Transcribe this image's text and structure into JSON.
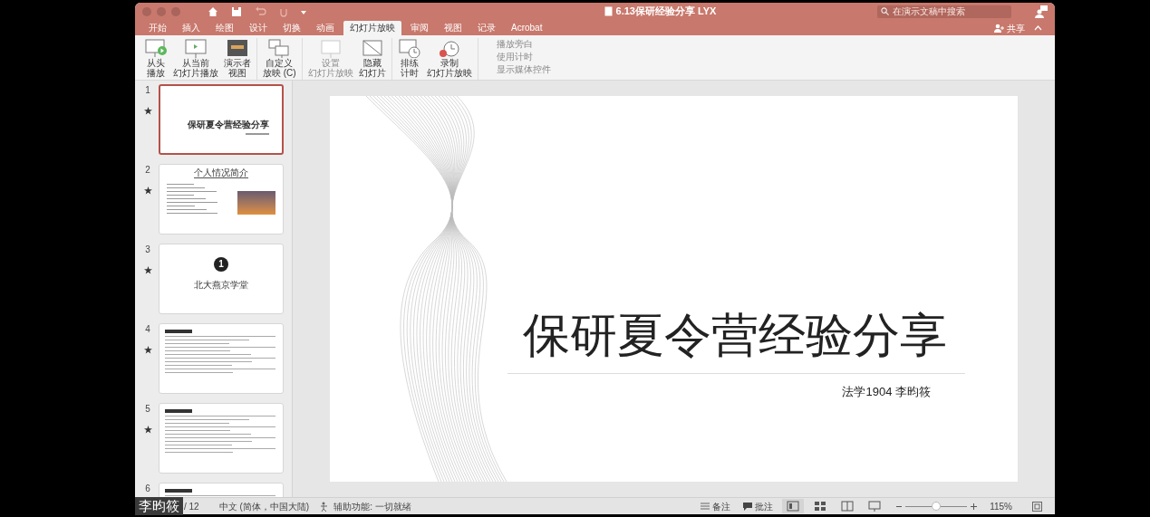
{
  "window": {
    "title": "6.13保研经验分享 LYX",
    "search": {
      "placeholder": "在演示文稿中搜索"
    },
    "share": "共享"
  },
  "tabs": [
    {
      "label": "开始",
      "selected": false
    },
    {
      "label": "插入",
      "selected": false
    },
    {
      "label": "绘图",
      "selected": false
    },
    {
      "label": "设计",
      "selected": false
    },
    {
      "label": "切换",
      "selected": false
    },
    {
      "label": "动画",
      "selected": false
    },
    {
      "label": "幻灯片放映",
      "selected": true
    },
    {
      "label": "审阅",
      "selected": false
    },
    {
      "label": "视图",
      "selected": false
    },
    {
      "label": "记录",
      "selected": false
    },
    {
      "label": "Acrobat",
      "selected": false
    }
  ],
  "ribbon": {
    "groups": [
      [
        {
          "kind": "play",
          "lines": [
            "从头",
            "播放"
          ],
          "disabled": false
        },
        {
          "kind": "current",
          "lines": [
            "从当前",
            "幻灯片播放"
          ],
          "disabled": false
        },
        {
          "kind": "presenter",
          "lines": [
            "演示者",
            "视图"
          ],
          "disabled": false
        }
      ],
      [
        {
          "kind": "custom",
          "lines": [
            "自定义",
            "放映 (C)"
          ],
          "disabled": false
        }
      ],
      [
        {
          "kind": "setup",
          "lines": [
            "设置",
            "幻灯片放映"
          ],
          "disabled": true
        },
        {
          "kind": "hide",
          "lines": [
            "隐藏",
            "幻灯片"
          ],
          "disabled": false
        }
      ],
      [
        {
          "kind": "rehearse",
          "lines": [
            "排练",
            "计时"
          ],
          "disabled": false
        },
        {
          "kind": "record",
          "lines": [
            "录制",
            "幻灯片放映"
          ],
          "disabled": false
        }
      ]
    ],
    "options": [
      {
        "label": "播放旁白",
        "disabled": true
      },
      {
        "label": "使用计时",
        "disabled": true
      },
      {
        "label": "显示媒体控件",
        "disabled": true
      }
    ]
  },
  "slides": [
    {
      "number": "1",
      "selected": true,
      "kind": "title",
      "title": "保研夏令营经验分享"
    },
    {
      "number": "2",
      "selected": false,
      "kind": "intro",
      "title": "个人情况简介"
    },
    {
      "number": "3",
      "selected": false,
      "kind": "section",
      "title": "北大燕京学堂",
      "mark": "1"
    },
    {
      "number": "4",
      "selected": false,
      "kind": "text"
    },
    {
      "number": "5",
      "selected": false,
      "kind": "text"
    },
    {
      "number": "6",
      "selected": false,
      "kind": "text"
    }
  ],
  "current_slide": {
    "title": "保研夏令营经验分享",
    "subtitle": "法学1904 李昀筱"
  },
  "status_bar": {
    "slide_counter": "/ 12",
    "language": "中文 (简体，中国大陆)",
    "accessibility": "辅助功能: 一切就绪",
    "notes": "备注",
    "comments": "批注",
    "views": [
      {
        "kind": "normal",
        "selected": true
      },
      {
        "kind": "sorter",
        "selected": false
      },
      {
        "kind": "reading",
        "selected": false
      },
      {
        "kind": "slideshow",
        "selected": false
      }
    ],
    "zoom": {
      "level": 0.5,
      "reading": "115%"
    }
  },
  "name_tag": "李昀筱"
}
